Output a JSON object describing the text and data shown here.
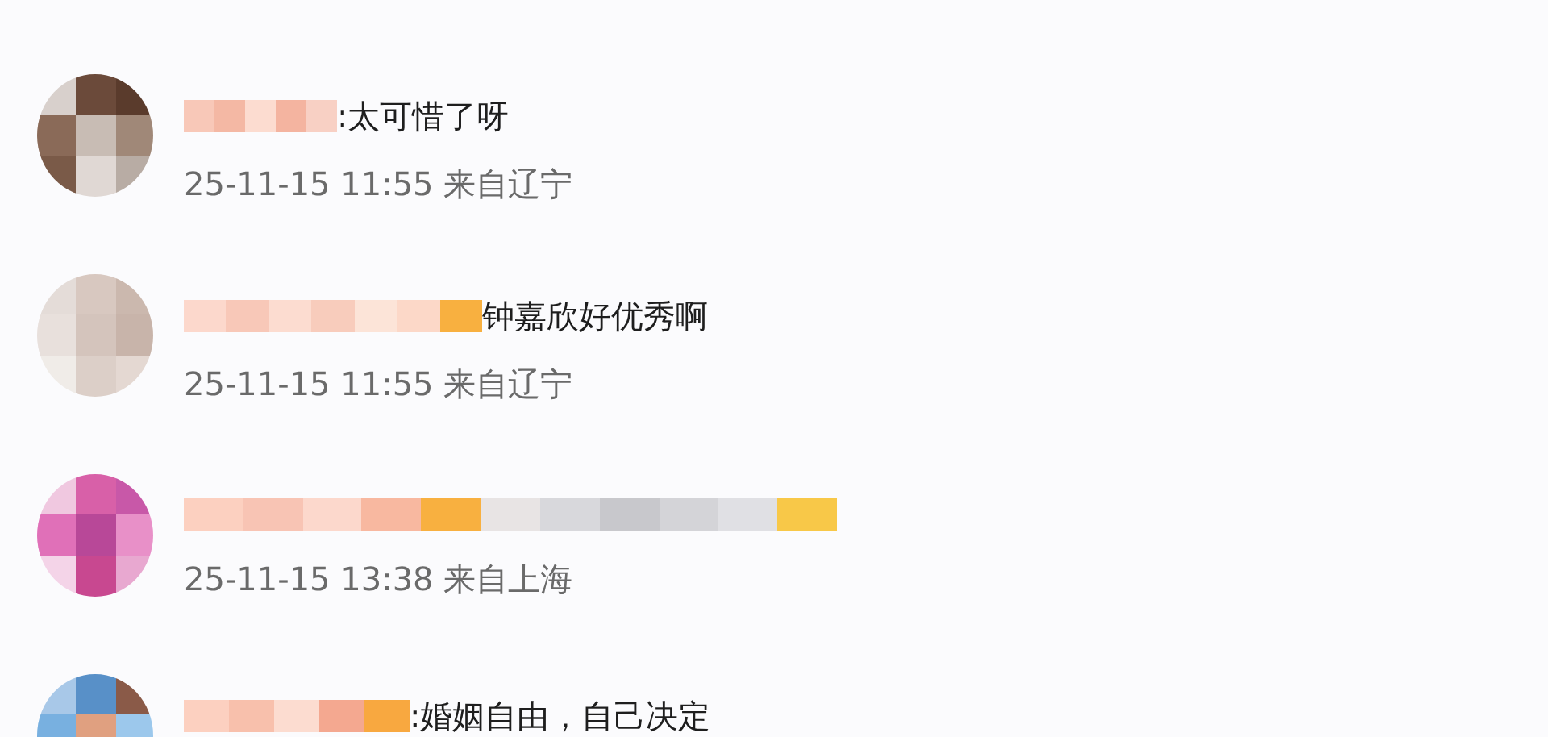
{
  "comments": [
    {
      "text": ":太可惜了呀",
      "meta": "25-11-15 11:55 来自辽宁"
    },
    {
      "text": "钟嘉欣好优秀啊",
      "meta": "25-11-15 11:55 来自辽宁"
    },
    {
      "meta": "25-11-15 13:38 来自上海"
    },
    {
      "text": ":婚姻自由，自己决定"
    }
  ]
}
